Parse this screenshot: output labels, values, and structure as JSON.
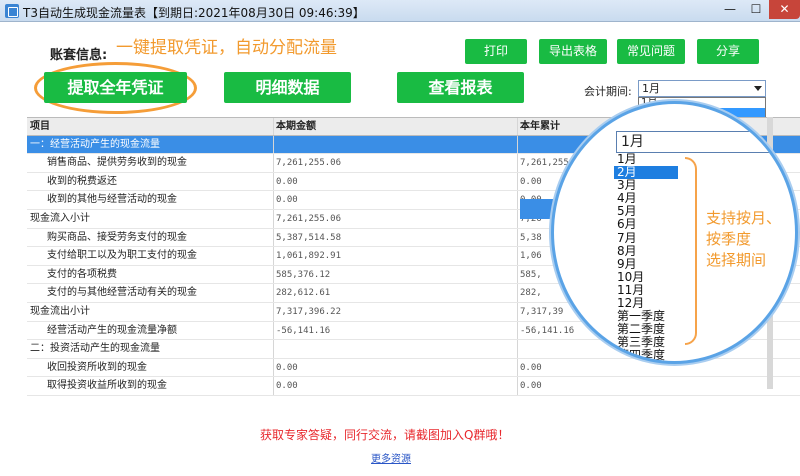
{
  "window": {
    "title": "T3自动生成现金流量表【到期日:2021年08月30日 09:46:39】",
    "controls": {
      "minimize": "—",
      "maximize": "☐",
      "close": "✕"
    }
  },
  "header": {
    "account_label": "账套信息:",
    "slogan": "一键提取凭证，自动分配流量",
    "toolbar": {
      "print": "打印",
      "export": "导出表格",
      "faq": "常见问题",
      "share": "分享"
    },
    "actions": {
      "extract": "提取全年凭证",
      "detail": "明细数据",
      "report": "查看报表"
    },
    "period_label": "会计期间:",
    "period_value": "1月",
    "mini_dropdown": [
      "1月",
      "1月",
      ""
    ]
  },
  "table": {
    "columns": [
      "项目",
      "本期金额",
      "本年累计"
    ],
    "rows": [
      {
        "name": "一：经营活动产生的现金流量",
        "current": "",
        "ytd": ""
      },
      {
        "name": "销售商品、提供劳务收到的现金",
        "current": "7,261,255.06",
        "ytd": "7,261,255"
      },
      {
        "name": "收到的税费返还",
        "current": "0.00",
        "ytd": "0.00"
      },
      {
        "name": "收到的其他与经营活动的现金",
        "current": "0.00",
        "ytd": "0.00"
      },
      {
        "name": "现金流入小计",
        "current": "7,261,255.06",
        "ytd": "7,26"
      },
      {
        "name": "购买商品、接受劳务支付的现金",
        "current": "5,387,514.58",
        "ytd": "5,38"
      },
      {
        "name": "支付给职工以及为职工支付的现金",
        "current": "1,061,892.91",
        "ytd": "1,06"
      },
      {
        "name": "支付的各项税费",
        "current": "585,376.12",
        "ytd": "585,"
      },
      {
        "name": "支付的与其他经营活动有关的现金",
        "current": "282,612.61",
        "ytd": "282,"
      },
      {
        "name": "现金流出小计",
        "current": "7,317,396.22",
        "ytd": "7,317,39"
      },
      {
        "name": "经营活动产生的现金流量净额",
        "current": "-56,141.16",
        "ytd": "-56,141.16"
      },
      {
        "name": "二：投资活动产生的现金流量",
        "current": "",
        "ytd": ""
      },
      {
        "name": "收回投资所收到的现金",
        "current": "0.00",
        "ytd": "0.00"
      },
      {
        "name": "取得投资收益所收到的现金",
        "current": "0.00",
        "ytd": "0.00"
      }
    ]
  },
  "magnifier": {
    "select_value": "1月",
    "options": [
      "1月",
      "2月",
      "3月",
      "4月",
      "5月",
      "6月",
      "7月",
      "8月",
      "9月",
      "10月",
      "11月",
      "12月",
      "第一季度",
      "第二季度",
      "第三季度",
      "第四季度"
    ],
    "highlighted_index": 1,
    "note_lines": [
      "支持按月、",
      "按季度",
      "选择期间"
    ],
    "accent_color": "#f29a2e"
  },
  "footer": {
    "notice": "获取专家答疑，同行交流，请截图加入Q群哦！",
    "link": "更多资源"
  }
}
